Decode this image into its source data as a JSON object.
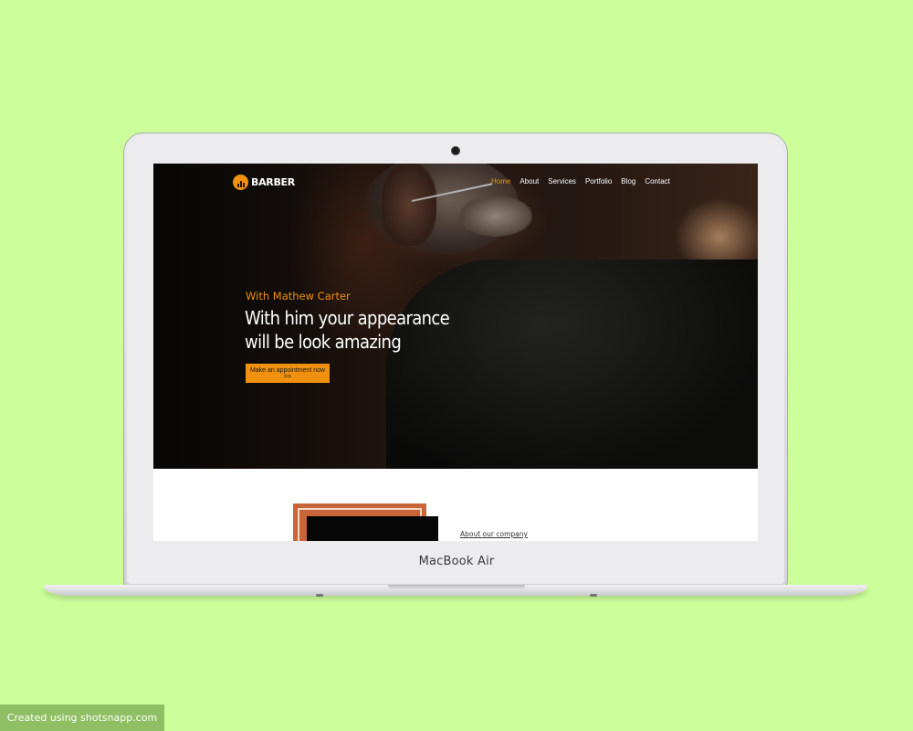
{
  "colors": {
    "background": "#ccff99",
    "accent": "#f0900f",
    "watermark_bg": "#8fbf63"
  },
  "device": {
    "model_label": "MacBook Air"
  },
  "site": {
    "logo_icon": "barber-pole-icon",
    "logo_text": "BARBER",
    "nav": [
      {
        "label": "Home",
        "active": true
      },
      {
        "label": "About",
        "active": false
      },
      {
        "label": "Services",
        "active": false
      },
      {
        "label": "Portfolio",
        "active": false
      },
      {
        "label": "Blog",
        "active": false
      },
      {
        "label": "Contact",
        "active": false
      }
    ],
    "hero": {
      "subtitle": "With Mathew Carter",
      "headline": "With him your appearance will be look amazing",
      "cta_label": "Make an appointment now >>"
    },
    "about": {
      "link_label": "About our company"
    }
  },
  "watermark": "Created using shotsnapp.com"
}
